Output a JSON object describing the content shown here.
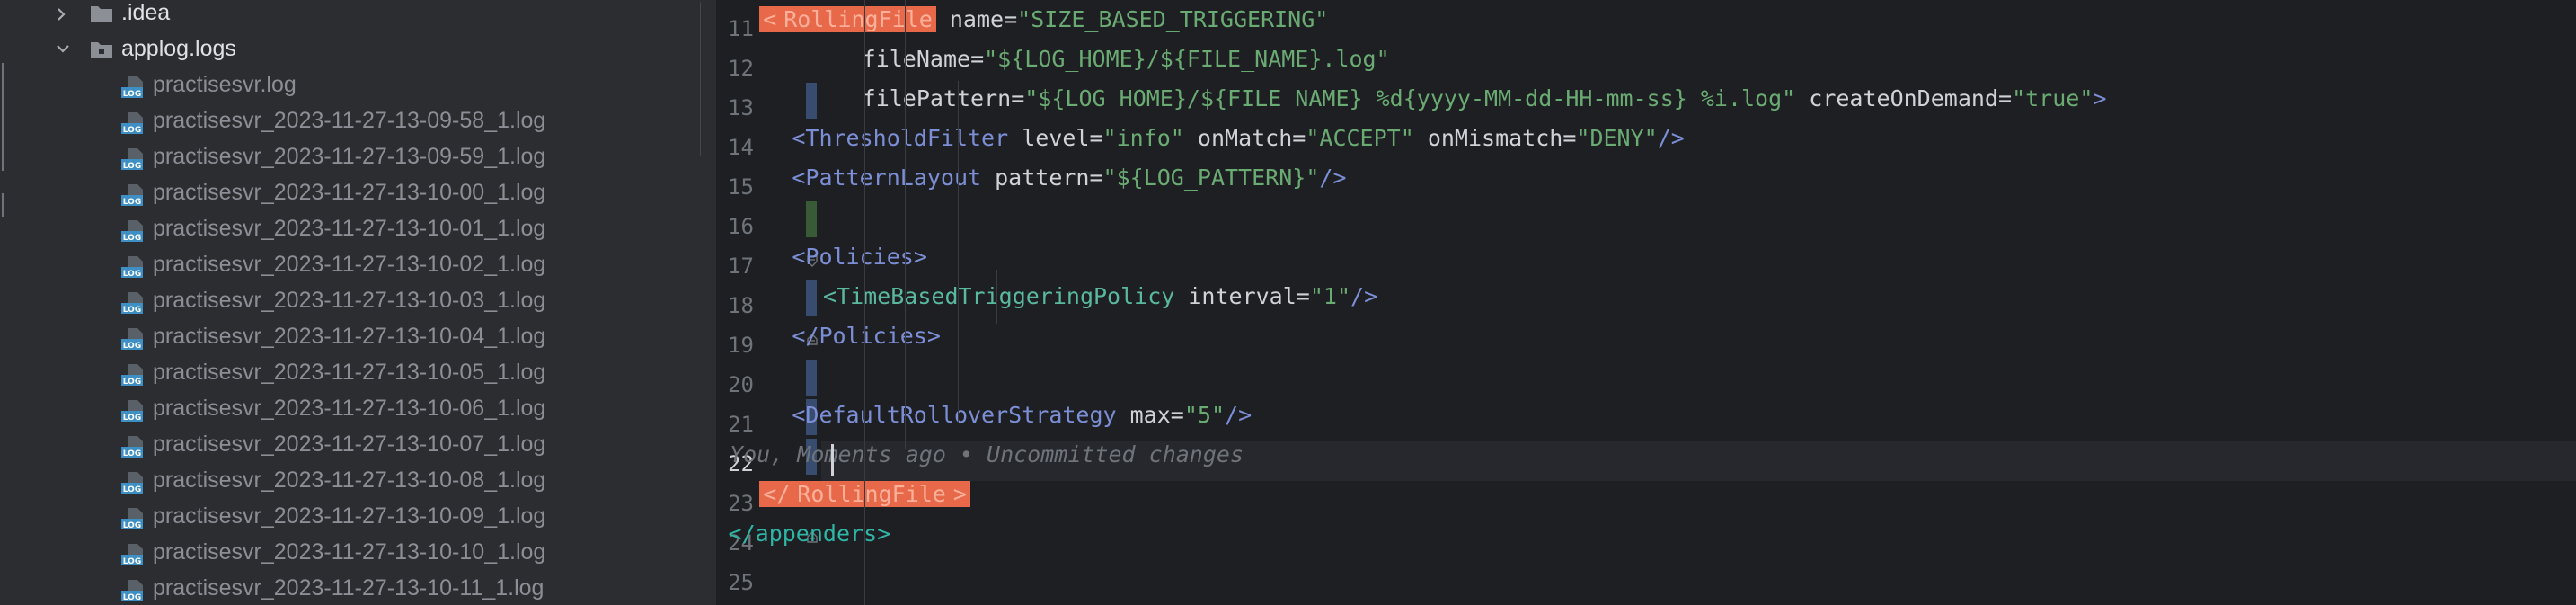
{
  "tree": {
    "items": [
      {
        "label": ".idea",
        "kind": "folder",
        "expanded": false
      },
      {
        "label": "applog.logs",
        "kind": "folder",
        "expanded": true
      },
      {
        "label": "practisesvr.log",
        "kind": "log"
      },
      {
        "label": "practisesvr_2023-11-27-13-09-58_1.log",
        "kind": "log"
      },
      {
        "label": "practisesvr_2023-11-27-13-09-59_1.log",
        "kind": "log"
      },
      {
        "label": "practisesvr_2023-11-27-13-10-00_1.log",
        "kind": "log"
      },
      {
        "label": "practisesvr_2023-11-27-13-10-01_1.log",
        "kind": "log"
      },
      {
        "label": "practisesvr_2023-11-27-13-10-02_1.log",
        "kind": "log"
      },
      {
        "label": "practisesvr_2023-11-27-13-10-03_1.log",
        "kind": "log"
      },
      {
        "label": "practisesvr_2023-11-27-13-10-04_1.log",
        "kind": "log"
      },
      {
        "label": "practisesvr_2023-11-27-13-10-05_1.log",
        "kind": "log"
      },
      {
        "label": "practisesvr_2023-11-27-13-10-06_1.log",
        "kind": "log"
      },
      {
        "label": "practisesvr_2023-11-27-13-10-07_1.log",
        "kind": "log"
      },
      {
        "label": "practisesvr_2023-11-27-13-10-08_1.log",
        "kind": "log"
      },
      {
        "label": "practisesvr_2023-11-27-13-10-09_1.log",
        "kind": "log"
      },
      {
        "label": "practisesvr_2023-11-27-13-10-10_1.log",
        "kind": "log"
      },
      {
        "label": "practisesvr_2023-11-27-13-10-11_1.log",
        "kind": "log"
      }
    ],
    "log_icon_text": "LOG"
  },
  "editor": {
    "active_line": 22,
    "line_numbers": [
      "11",
      "12",
      "13",
      "14",
      "15",
      "16",
      "17",
      "18",
      "19",
      "20",
      "21",
      "22",
      "23",
      "24",
      "25"
    ],
    "lines": [
      [
        {
          "t": "<",
          "c": "hl"
        },
        {
          "t": "RollingFile",
          "c": "hl"
        },
        {
          "t": " name",
          "c": "attr"
        },
        {
          "t": "=",
          "c": "eq"
        },
        {
          "t": "\"SIZE_BASED_TRIGGERING\"",
          "c": "str"
        }
      ],
      [
        {
          "t": "fileName",
          "c": "attr"
        },
        {
          "t": "=",
          "c": "eq"
        },
        {
          "t": "\"${LOG_HOME}/${FILE_NAME}.log\"",
          "c": "str"
        }
      ],
      [
        {
          "t": "filePattern",
          "c": "attr"
        },
        {
          "t": "=",
          "c": "eq"
        },
        {
          "t": "\"${LOG_HOME}/${FILE_NAME}_%d{yyyy-MM-dd-HH-mm-ss}_%i.log\"",
          "c": "str"
        },
        {
          "t": " createOnDemand",
          "c": "attr"
        },
        {
          "t": "=",
          "c": "eq"
        },
        {
          "t": "\"true\"",
          "c": "str"
        },
        {
          "t": ">",
          "c": "brk"
        }
      ],
      [
        {
          "t": "<",
          "c": "brk"
        },
        {
          "t": "ThresholdFilter",
          "c": "tag"
        },
        {
          "t": " level",
          "c": "attr"
        },
        {
          "t": "=",
          "c": "eq"
        },
        {
          "t": "\"info\"",
          "c": "str"
        },
        {
          "t": " onMatch",
          "c": "attr"
        },
        {
          "t": "=",
          "c": "eq"
        },
        {
          "t": "\"ACCEPT\"",
          "c": "str"
        },
        {
          "t": " onMismatch",
          "c": "attr"
        },
        {
          "t": "=",
          "c": "eq"
        },
        {
          "t": "\"DENY\"",
          "c": "str"
        },
        {
          "t": "/>",
          "c": "brk"
        }
      ],
      [
        {
          "t": "<",
          "c": "brk"
        },
        {
          "t": "PatternLayout",
          "c": "tag"
        },
        {
          "t": " pattern",
          "c": "attr"
        },
        {
          "t": "=",
          "c": "eq"
        },
        {
          "t": "\"${LOG_PATTERN}\"",
          "c": "str"
        },
        {
          "t": "/>",
          "c": "brk"
        }
      ],
      [],
      [
        {
          "t": "<",
          "c": "brk"
        },
        {
          "t": "Policies",
          "c": "tag"
        },
        {
          "t": ">",
          "c": "brk"
        }
      ],
      [
        {
          "t": "<",
          "c": "teal"
        },
        {
          "t": "TimeBasedTriggeringPolicy",
          "c": "teal"
        },
        {
          "t": " interval",
          "c": "attr"
        },
        {
          "t": "=",
          "c": "eq"
        },
        {
          "t": "\"1\"",
          "c": "str"
        },
        {
          "t": "/>",
          "c": "brk"
        }
      ],
      [
        {
          "t": "</",
          "c": "brk"
        },
        {
          "t": "Policies",
          "c": "tag"
        },
        {
          "t": ">",
          "c": "brk"
        }
      ],
      [],
      [
        {
          "t": "<",
          "c": "brk"
        },
        {
          "t": "DefaultRolloverStrategy",
          "c": "tag"
        },
        {
          "t": " max",
          "c": "attr"
        },
        {
          "t": "=",
          "c": "eq"
        },
        {
          "t": "\"5\"",
          "c": "str"
        },
        {
          "t": "/>",
          "c": "brk"
        }
      ],
      [
        {
          "t": "You, Moments ago • Uncommitted changes",
          "c": "blame"
        }
      ],
      [
        {
          "t": "</",
          "c": "hl"
        },
        {
          "t": "RollingFile",
          "c": "hl"
        },
        {
          "t": ">",
          "c": "hl"
        }
      ],
      [
        {
          "t": "</",
          "c": "green"
        },
        {
          "t": "appenders",
          "c": "green"
        },
        {
          "t": ">",
          "c": "green"
        }
      ],
      []
    ]
  },
  "colors": {
    "vcs_modified": "#374c6e",
    "vcs_added": "#395a36",
    "highlight_tag": "#e8694a"
  }
}
